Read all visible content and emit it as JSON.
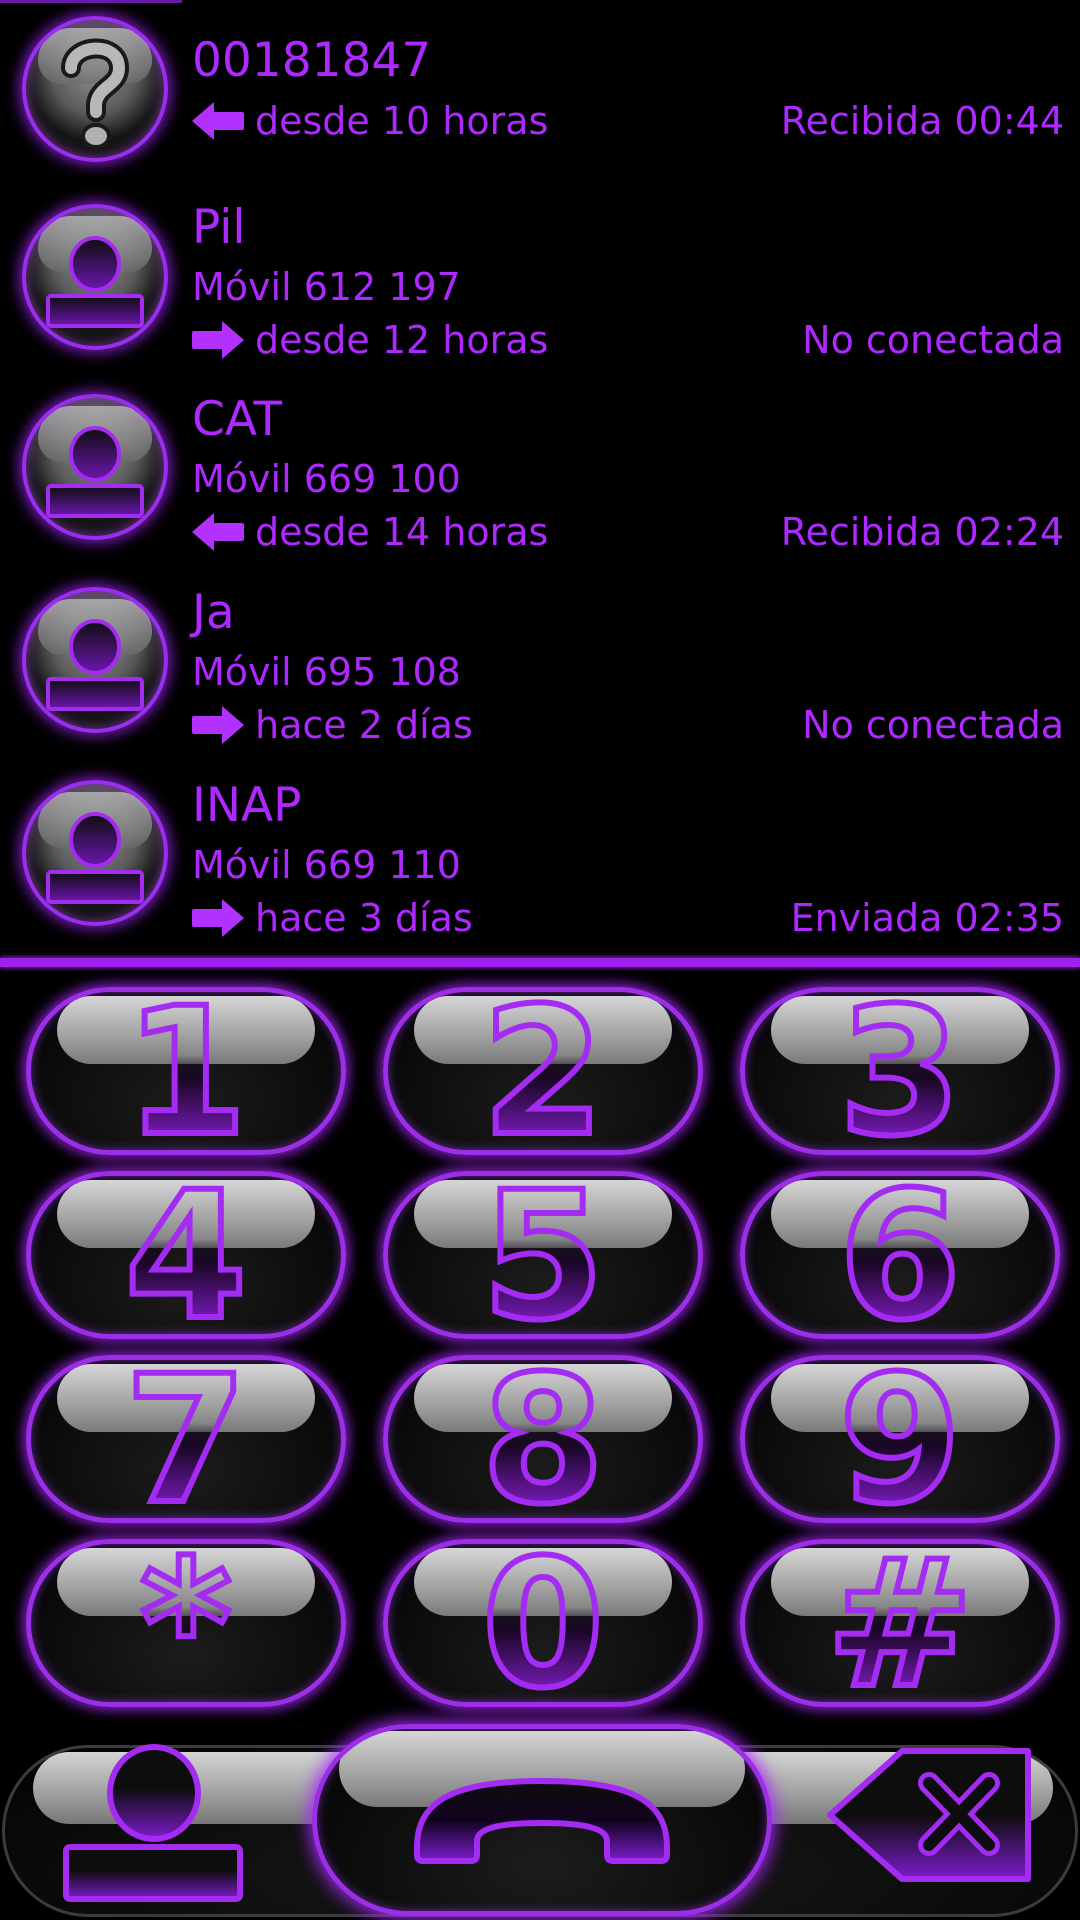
{
  "colors": {
    "accent": "#ad29ff",
    "background": "#000000"
  },
  "call_log": [
    {
      "name": "00181847",
      "number": "",
      "avatar_icon": "unknown-caller-question-icon",
      "direction_icon": "incoming-arrow-left-icon",
      "when": "desde 10 horas",
      "status": "Recibida 00:44"
    },
    {
      "name": "Pil",
      "number": "Móvil 612 197",
      "avatar_icon": "contact-silhouette-icon",
      "direction_icon": "outgoing-arrow-right-icon",
      "when": "desde 12 horas",
      "status": "No conectada"
    },
    {
      "name": "CAT",
      "number": "Móvil 669 100",
      "avatar_icon": "contact-silhouette-icon",
      "direction_icon": "incoming-arrow-left-icon",
      "when": "desde 14 horas",
      "status": "Recibida 02:24"
    },
    {
      "name": "Ja",
      "number": "Móvil 695 108",
      "avatar_icon": "contact-silhouette-icon",
      "direction_icon": "outgoing-arrow-right-icon",
      "when": "hace 2 días",
      "status": "No conectada"
    },
    {
      "name": "INAP",
      "number": "Móvil 669 110",
      "avatar_icon": "contact-silhouette-icon",
      "direction_icon": "outgoing-arrow-right-icon",
      "when": "hace 3 días",
      "status": "Enviada 02:35"
    }
  ],
  "dialpad": {
    "keys": [
      "1",
      "2",
      "3",
      "4",
      "5",
      "6",
      "7",
      "8",
      "9",
      "*",
      "0",
      "#"
    ]
  },
  "bottom_bar": {
    "contacts_icon": "contacts-silhouette-icon",
    "call_icon": "phone-handset-icon",
    "delete_icon": "backspace-delete-icon"
  }
}
